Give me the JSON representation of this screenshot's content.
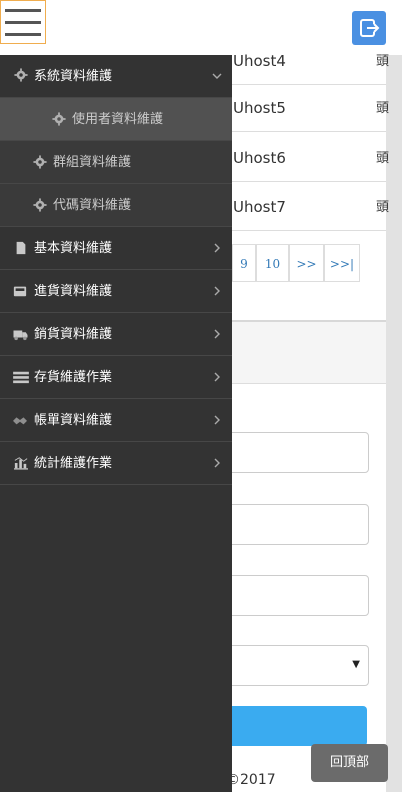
{
  "header": {
    "menu_icon": "hamburger-icon",
    "logout_icon": "logout-icon",
    "logout_color": "#4a90e2"
  },
  "table": {
    "rows": [
      {
        "host": "Uhost4",
        "extra": "頭"
      },
      {
        "host": "Uhost5",
        "extra": "頭"
      },
      {
        "host": "Uhost6",
        "extra": "頭"
      },
      {
        "host": "Uhost7",
        "extra": "頭"
      }
    ]
  },
  "pagination": [
    "9",
    "10",
    ">>",
    ">>|"
  ],
  "form": {
    "select_arrow": "▼",
    "submit_color": "#3aabf0"
  },
  "footer": {
    "copyright": "©2017",
    "back_to_top": "回頂部"
  },
  "drawer": {
    "background": "#333333",
    "items": [
      {
        "label": "系統資料維護",
        "icon": "gear-icon",
        "arrow": "chevron-down-icon"
      },
      {
        "label": "使用者資料維護",
        "icon": "gear-icon"
      },
      {
        "label": "群組資料維護",
        "icon": "gear-icon"
      },
      {
        "label": "代碼資料維護",
        "icon": "gear-icon"
      },
      {
        "label": "基本資料維護",
        "icon": "file-icon",
        "arrow": "chevron-right-icon"
      },
      {
        "label": "進貨資料維護",
        "icon": "inbox-icon",
        "arrow": "chevron-right-icon"
      },
      {
        "label": "銷貨資料維護",
        "icon": "truck-icon",
        "arrow": "chevron-right-icon"
      },
      {
        "label": "存貨維護作業",
        "icon": "stack-icon",
        "arrow": "chevron-right-icon"
      },
      {
        "label": "帳單資料維護",
        "icon": "handshake-icon",
        "arrow": "chevron-right-icon"
      },
      {
        "label": "統計維護作業",
        "icon": "bar-chart-icon",
        "arrow": "chevron-right-icon"
      }
    ]
  }
}
